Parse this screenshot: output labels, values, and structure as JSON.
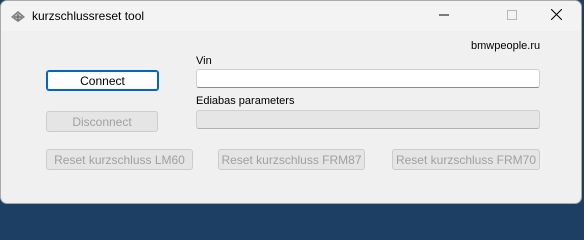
{
  "window": {
    "title": "kurzschlussreset tool",
    "icon": "app-icon"
  },
  "site_link": "bmwpeople.ru",
  "labels": {
    "vin": "Vin",
    "ediabas": "Ediabas parameters"
  },
  "fields": {
    "vin_value": "",
    "ediabas_value": ""
  },
  "buttons": {
    "connect": "Connect",
    "disconnect": "Disconnect",
    "reset_lm60": "Reset kurzschluss LM60",
    "reset_frm87": "Reset kurzschluss FRM87",
    "reset_frm70": "Reset kurzschluss FRM70"
  },
  "colors": {
    "accent": "#0067c0",
    "window_bg": "#f0f0f0",
    "disabled_text": "#a0a0a0"
  }
}
